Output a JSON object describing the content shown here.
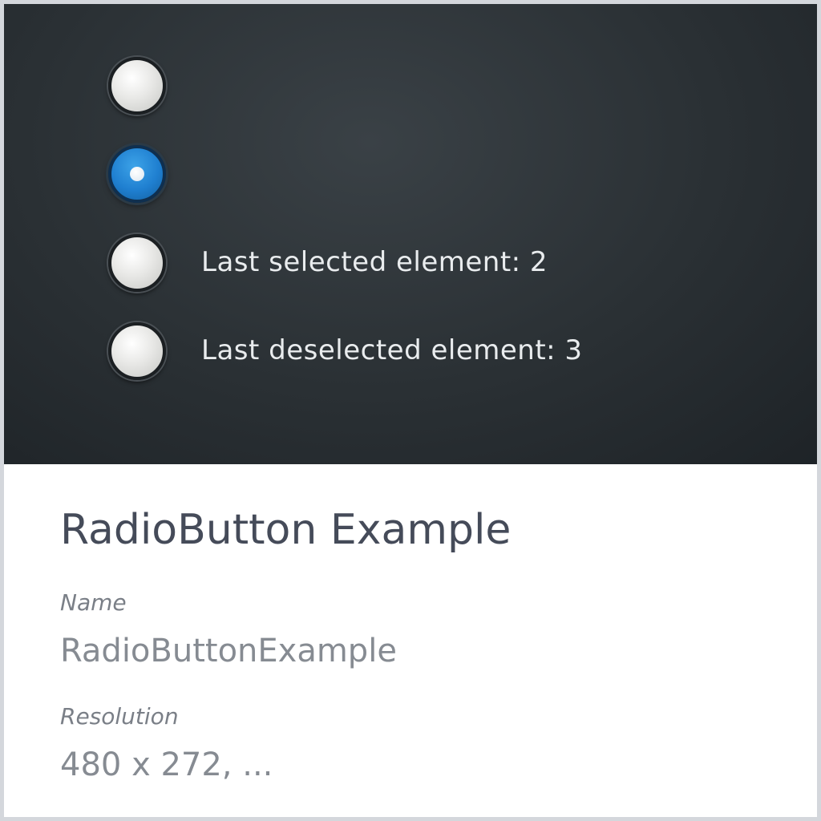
{
  "preview": {
    "radio_buttons": [
      {
        "checked": false
      },
      {
        "checked": true
      },
      {
        "checked": false
      },
      {
        "checked": false
      }
    ],
    "last_selected": "Last selected element: 2",
    "last_deselected": "Last deselected element: 3"
  },
  "info": {
    "title": "RadioButton Example",
    "name_label": "Name",
    "name_value": "RadioButtonExample",
    "resolution_label": "Resolution",
    "resolution_value": "480 x 272, ..."
  },
  "colors": {
    "preview_background": "#2a3034",
    "radio_selected": "#1f7fd0",
    "radio_unselected": "#e8e8e6",
    "title_text": "#454b59",
    "label_text": "#7a7f87",
    "value_text": "#868b92"
  }
}
